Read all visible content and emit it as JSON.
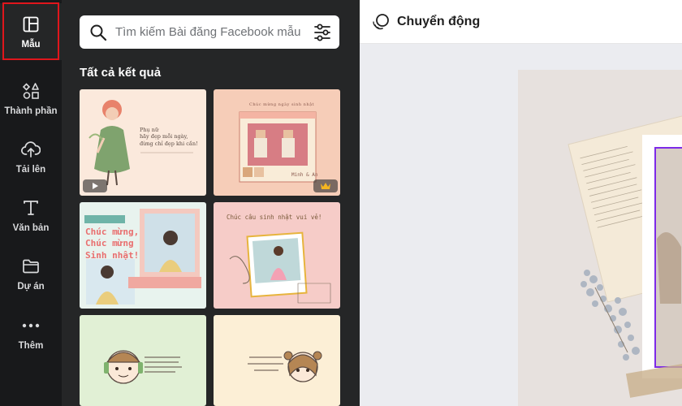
{
  "sidebar": {
    "items": [
      {
        "label": "Mẫu",
        "icon": "layout-template-icon"
      },
      {
        "label": "Thành phần",
        "icon": "elements-icon"
      },
      {
        "label": "Tải lên",
        "icon": "cloud-upload-icon"
      },
      {
        "label": "Văn bản",
        "icon": "text-icon"
      },
      {
        "label": "Dự án",
        "icon": "folder-icon"
      },
      {
        "label": "Thêm",
        "icon": "more-dots-icon"
      }
    ],
    "active_index": 0
  },
  "search": {
    "placeholder": "Tìm kiếm Bài đăng Facebook mẫu",
    "value": ""
  },
  "results": {
    "title": "Tất cả kết quả",
    "templates": [
      {
        "text": "Phụ nữ\nhãy đẹp mỗi ngày,\nđừng chỉ đẹp khi cần!",
        "badge": "video-play-icon"
      },
      {
        "text": "Chúc mừng ngày sinh nhật",
        "caption": "Minh & An",
        "badge": "crown-premium-icon"
      },
      {
        "text": "Chúc mừng,\nChúc mừng\nSinh nhật!"
      },
      {
        "text": "Chúc câu sinh nhật vui vẻ!"
      },
      {
        "text": ""
      },
      {
        "text": ""
      }
    ]
  },
  "topbar": {
    "animate_label": "Chuyển động"
  },
  "colors": {
    "rail_bg": "#18191b",
    "panel_bg": "#252627",
    "active_outline": "#e0161c",
    "canvas_bg": "#ebecf0"
  }
}
